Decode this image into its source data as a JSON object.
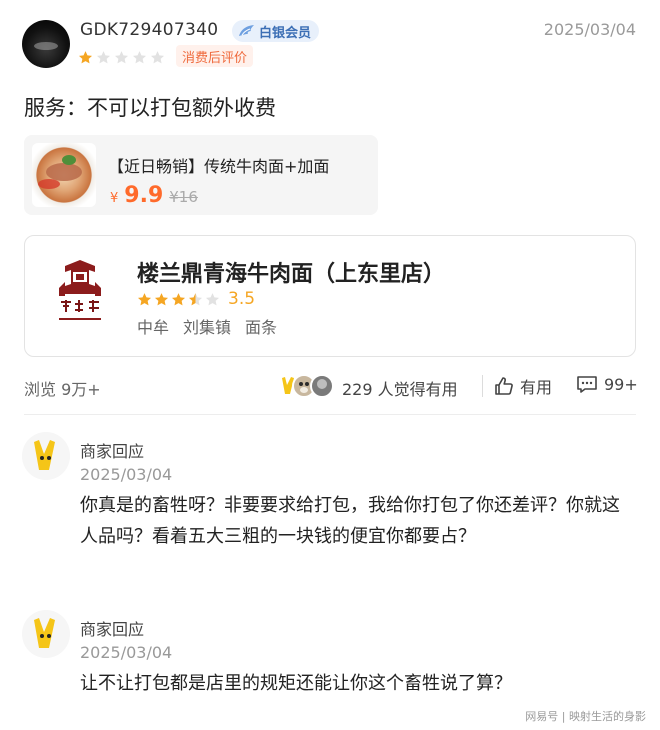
{
  "review": {
    "username": "GDK729407340",
    "member_badge": "白银会员",
    "date": "2025/03/04",
    "rating": 1,
    "tag": "消费后评价",
    "text": "服务：不可以打包额外收费"
  },
  "product": {
    "name": "【近日畅销】传统牛肉面+加面",
    "currency": "¥",
    "price": "9.9",
    "original_price": "¥16"
  },
  "store": {
    "name": "楼兰鼎青海牛肉面（上东里店）",
    "rating": "3.5",
    "rating_value": 3.5,
    "tags": [
      "中牟",
      "刘集镇",
      "面条"
    ]
  },
  "stats": {
    "views": "浏览 9万+",
    "helpful": "229 人觉得有用",
    "useful_label": "有用",
    "comments": "99+"
  },
  "replies": [
    {
      "title": "商家回应",
      "date": "2025/03/04",
      "text": "你真是的畜牲呀？非要要求给打包，我给你打包了你还差评？你就这人品吗？看着五大三粗的一块钱的便宜你都要占？"
    },
    {
      "title": "商家回应",
      "date": "2025/03/04",
      "text": "让不让打包都是店里的规矩还能让你这个畜牲说了算？"
    }
  ],
  "watermark": "网易号 | 映射生活的身影",
  "colors": {
    "star": "#f5a623",
    "price": "#ff6a2b",
    "badge_text": "#3c6fb5",
    "tag_text": "#ef6a3d"
  }
}
